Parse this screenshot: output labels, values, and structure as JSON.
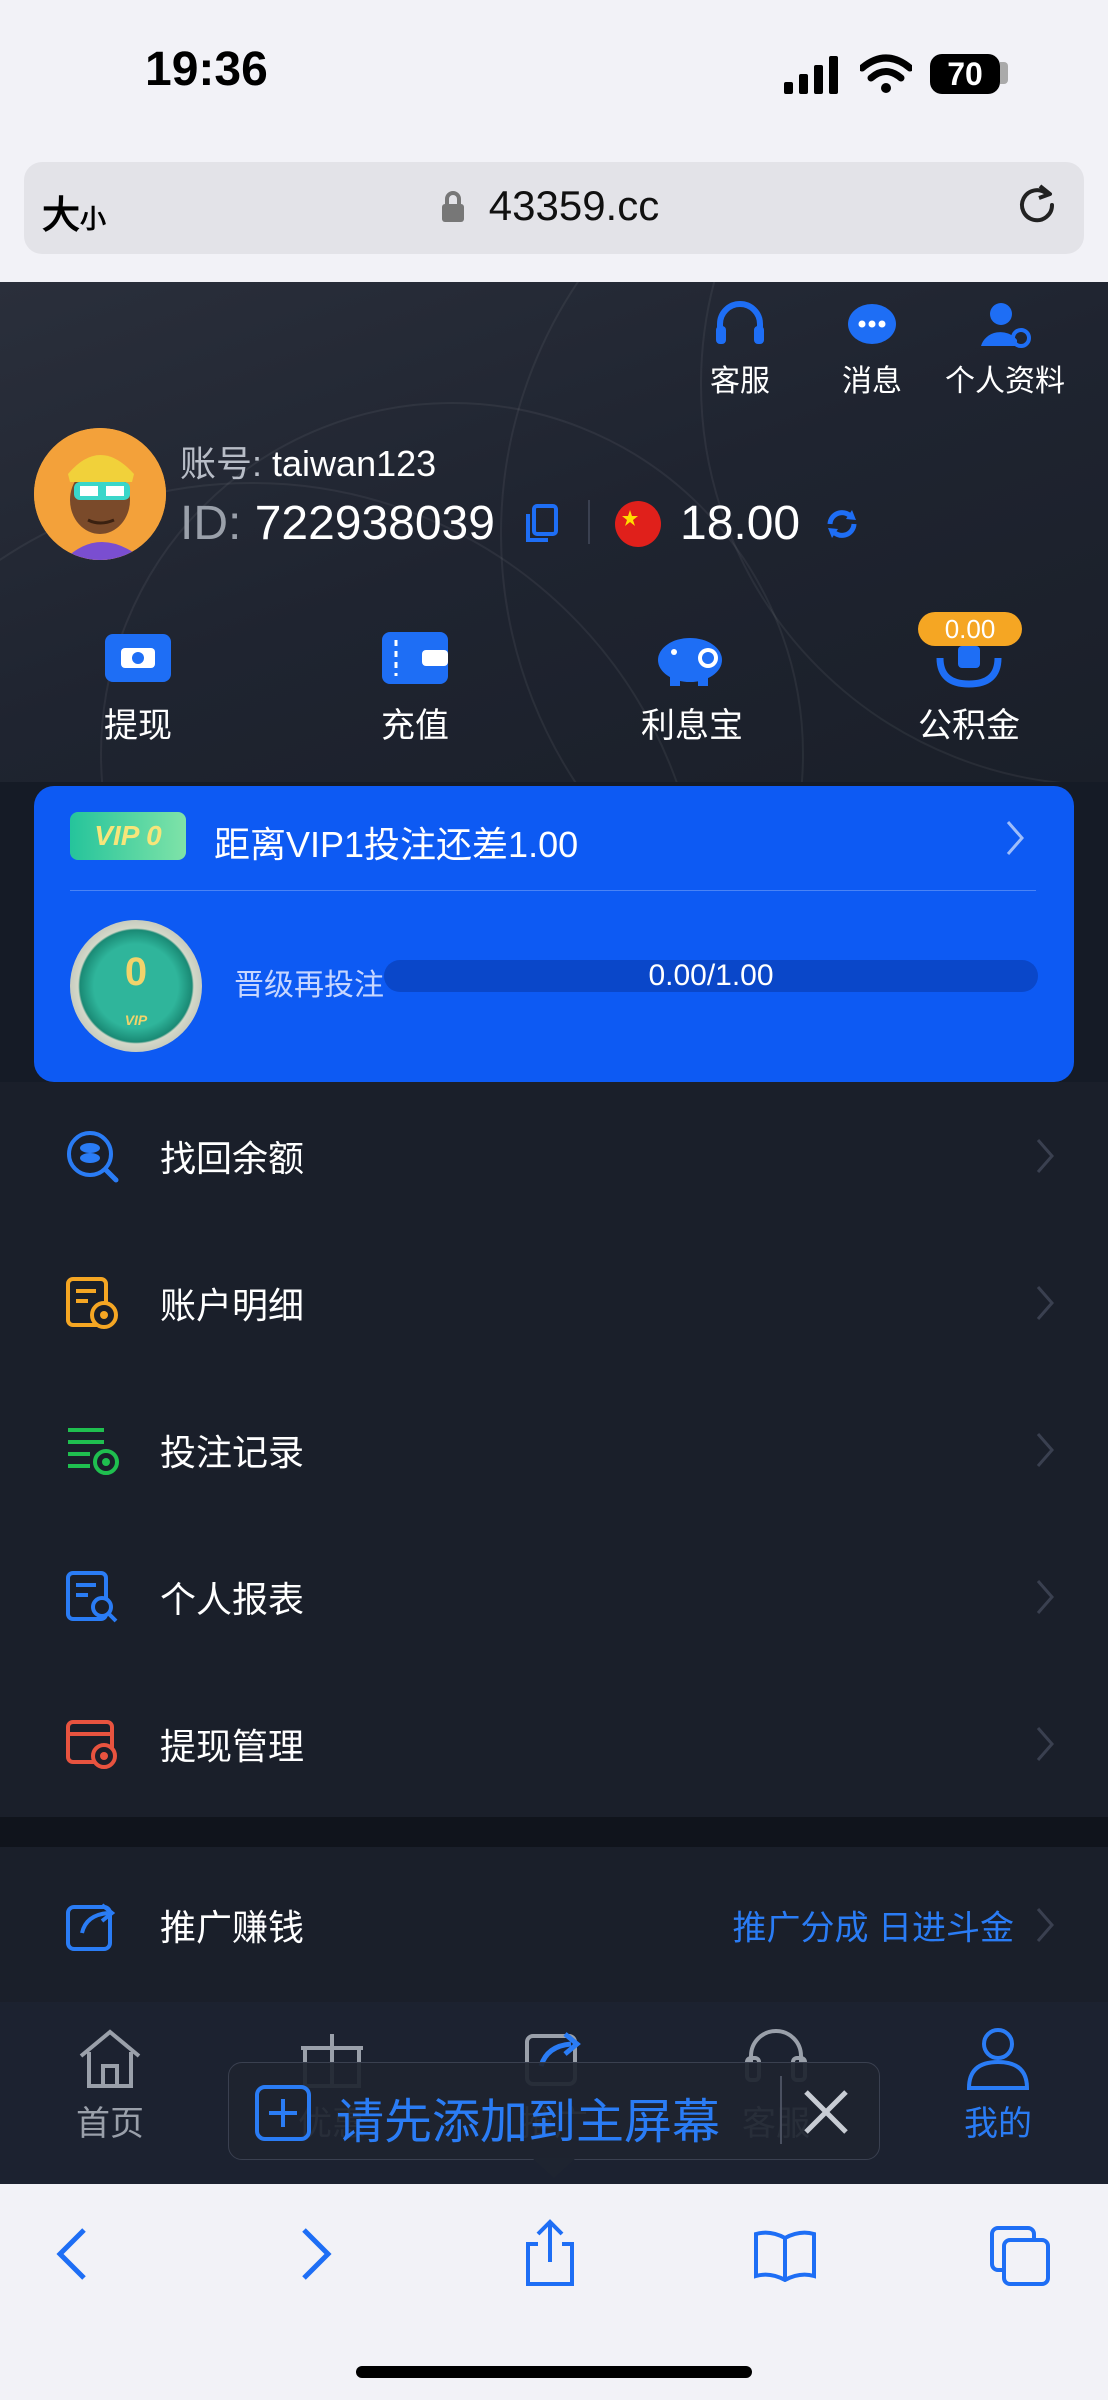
{
  "status_bar": {
    "time": "19:36",
    "battery": "70"
  },
  "browser": {
    "font_size_label": "大",
    "font_size_small": "小",
    "url": "43359.cc"
  },
  "header": {
    "top_icons": [
      {
        "label": "客服",
        "icon": "headset-icon"
      },
      {
        "label": "消息",
        "icon": "message-icon"
      },
      {
        "label": "个人资料",
        "icon": "profile-settings-icon"
      }
    ],
    "account_label": "账号:",
    "account": "taiwan123",
    "id_label": "ID:",
    "id": "722938039",
    "balance": "18.00",
    "quick_actions": [
      {
        "label": "提现",
        "icon": "withdraw-icon"
      },
      {
        "label": "充值",
        "icon": "wallet-icon"
      },
      {
        "label": "利息宝",
        "icon": "piggy-bank-icon"
      },
      {
        "label": "公积金",
        "icon": "fund-icon",
        "badge": "0.00"
      }
    ]
  },
  "vip": {
    "badge": "VIP 0",
    "message": "距离VIP1投注还差1.00",
    "level": "0",
    "medal_text": "VIP",
    "upgrade_label": "晋级再投注",
    "progress_text": "0.00/1.00",
    "progress": 0
  },
  "menu": [
    {
      "label": "找回余额",
      "icon": "recover-balance-icon",
      "color": "#2a7cf5"
    },
    {
      "label": "账户明细",
      "icon": "account-detail-icon",
      "color": "#f5a623"
    },
    {
      "label": "投注记录",
      "icon": "bet-record-icon",
      "color": "#1fbf4f"
    },
    {
      "label": "个人报表",
      "icon": "report-icon",
      "color": "#2a7cf5"
    },
    {
      "label": "提现管理",
      "icon": "withdraw-manage-icon",
      "color": "#e8533f"
    }
  ],
  "promo": {
    "label": "推广赚钱",
    "extra": "推广分成 日进斗金",
    "icon": "share-icon"
  },
  "tabs": [
    {
      "label": "首页",
      "icon": "home-icon"
    },
    {
      "label": "优惠",
      "icon": "gift-icon"
    },
    {
      "label": "推广",
      "icon": "share-icon"
    },
    {
      "label": "客服",
      "icon": "headset-icon"
    },
    {
      "label": "我的",
      "icon": "user-icon"
    }
  ],
  "install_banner": {
    "text": "请先添加到主屏幕"
  }
}
